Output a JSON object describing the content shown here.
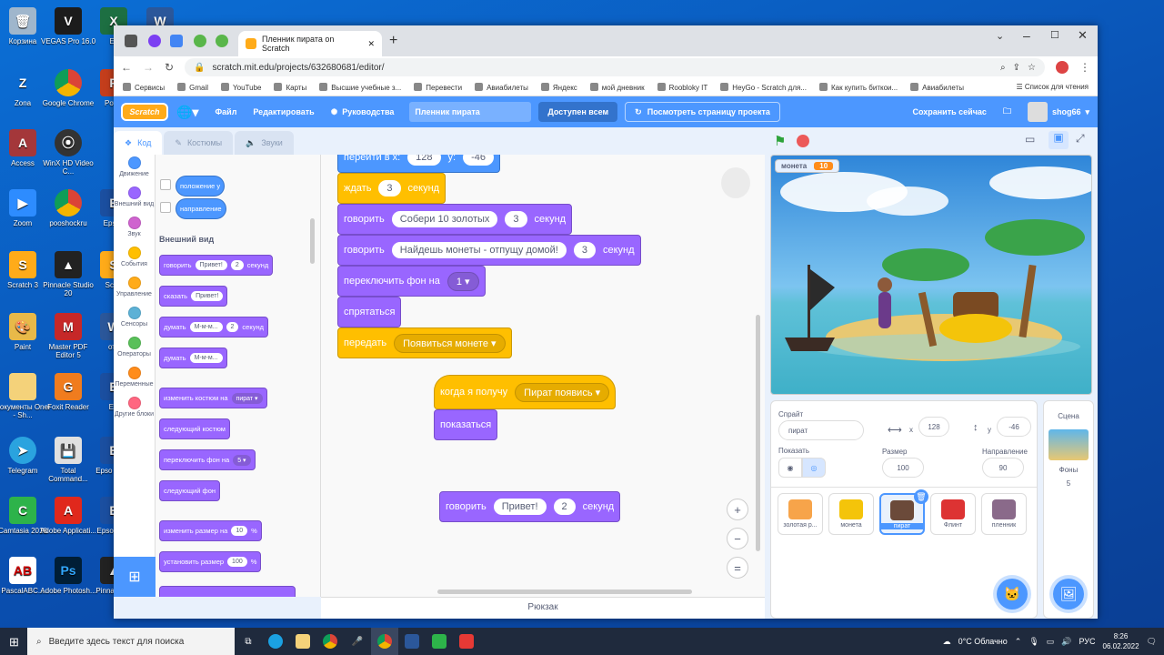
{
  "desktop": {
    "col1": [
      "Корзина",
      "Zona",
      "Access",
      "Zoom",
      "Scratch 3",
      "Paint",
      "Документы Oner - Sh...",
      "Telegram",
      "Camtasia 2018",
      "PascalABC..."
    ],
    "col2": [
      "VEGAS Pro 16.0",
      "Google Chrome",
      "WinX HD Video C...",
      "pooshockru",
      "Pinnacle Studio 20",
      "Master PDF Editor 5",
      "Foxit Reader",
      "Total Command...",
      "Adobe Applicati...",
      "Adobe Photosh..."
    ],
    "col3": [
      "Ex",
      "Powe",
      "",
      "Epson",
      "Scrat",
      "отч",
      "EP",
      "Epso Conn",
      "Epso Phot",
      "Pinna Stud"
    ]
  },
  "browser": {
    "tab_title": "Пленник пирата on Scratch",
    "url": "scratch.mit.edu/projects/632680681/editor/",
    "bookmarks": [
      "Сервисы",
      "Gmail",
      "YouTube",
      "Карты",
      "Высшие учебные з...",
      "Перевести",
      "Авиабилеты",
      "Яндекс",
      "мой дневник",
      "Roobloky IT",
      "HeyGo - Scratch для...",
      "Как купить биткои...",
      "Авиабилеты"
    ],
    "reading_list": "Список для чтения"
  },
  "menu": {
    "logo": "Scratch",
    "file": "Файл",
    "edit": "Редактировать",
    "tutorials": "Руководства",
    "project_title": "Пленник пирата",
    "share": "Доступен всем",
    "see_page": "Посмотреть страницу проекта",
    "save_now": "Сохранить сейчас",
    "username": "shog66"
  },
  "editor_tabs": [
    "Код",
    "Костюмы",
    "Звуки"
  ],
  "categories": [
    {
      "label": "Движение",
      "color": "#4c97ff"
    },
    {
      "label": "Внешний вид",
      "color": "#9966ff"
    },
    {
      "label": "Звук",
      "color": "#cf63cf"
    },
    {
      "label": "События",
      "color": "#ffbf00"
    },
    {
      "label": "Управление",
      "color": "#ffab19"
    },
    {
      "label": "Сенсоры",
      "color": "#5cb1d6"
    },
    {
      "label": "Операторы",
      "color": "#59c059"
    },
    {
      "label": "Переменные",
      "color": "#ff8c1a"
    },
    {
      "label": "Другие блоки",
      "color": "#ff6680"
    }
  ],
  "palette": {
    "motion_reporters": [
      "положение у",
      "направление"
    ],
    "looks_heading": "Внешний вид",
    "blocks": {
      "say_secs": {
        "say": "говорить",
        "msg": "Привет!",
        "secs": "2",
        "unit": "секунд"
      },
      "say": {
        "say": "сказать",
        "msg": "Привет!"
      },
      "think_secs": {
        "think": "думать",
        "msg": "М-м-м...",
        "secs": "2",
        "unit": "секунд"
      },
      "think": {
        "think": "думать",
        "msg": "М-м-м..."
      },
      "switch_costume": {
        "label": "изменить костюм на",
        "value": "пират"
      },
      "next_costume": "следующий костюм",
      "switch_backdrop": {
        "label": "переключить фон на",
        "value": "5"
      },
      "next_backdrop": "следующий фон",
      "change_size": {
        "label": "изменить размер на",
        "value": "10",
        "unit": "%"
      },
      "set_size": {
        "label": "установить размер",
        "value": "100",
        "unit": "%"
      }
    }
  },
  "script": {
    "goto": {
      "label": "перейти в x:",
      "x": "128",
      "ylabel": "y:",
      "y": "-46"
    },
    "wait": {
      "label": "ждать",
      "value": "3",
      "unit": "секунд"
    },
    "say1": {
      "label": "говорить",
      "msg": "Собери 10 золотых",
      "secs": "3",
      "unit": "секунд"
    },
    "say2": {
      "label": "говорить",
      "msg": "Найдешь монеты - отпущу домой!",
      "secs": "3",
      "unit": "секунд"
    },
    "backdrop": {
      "label": "переключить фон на",
      "value": "1"
    },
    "hide": "спрятаться",
    "broadcast": {
      "label": "передать",
      "value": "Появиться монете"
    },
    "when_receive": {
      "label": "когда я получу",
      "value": "Пират появись"
    },
    "show": "показаться",
    "loose_say": {
      "label": "говорить",
      "msg": "Привет!",
      "secs": "2",
      "unit": "секунд"
    }
  },
  "backpack": "Рюкзак",
  "stage": {
    "monitor_label": "монета",
    "monitor_value": "10"
  },
  "sprite_info": {
    "sprite_label": "Спрайт",
    "sprite_name": "пират",
    "x": "128",
    "y": "-46",
    "show_label": "Показать",
    "size_label": "Размер",
    "size": "100",
    "direction_label": "Направление",
    "direction": "90"
  },
  "sprites": [
    "золотая р...",
    "монета",
    "пират",
    "Флинт",
    "пленник"
  ],
  "scene": {
    "label": "Сцена",
    "backdrops_label": "Фоны",
    "backdrops_count": "5"
  },
  "taskbar": {
    "search": "Введите здесь текст для поиска",
    "weather": "0°C Облачно",
    "lang": "РУС",
    "time": "8:26",
    "date": "06.02.2022"
  }
}
